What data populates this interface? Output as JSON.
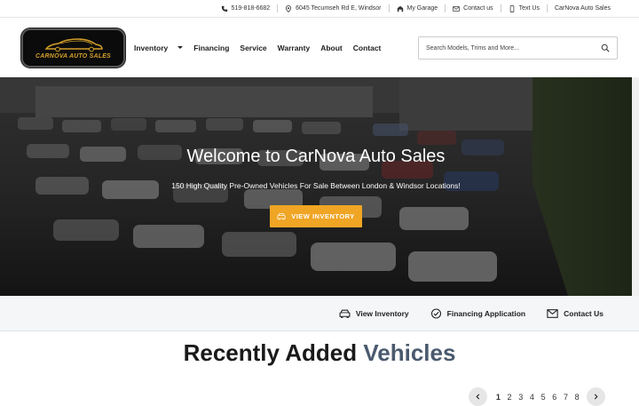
{
  "topbar": {
    "phone": "519-818-6682",
    "address": "6045 Tecumseh Rd E, Windsor",
    "garage": "My Garage",
    "contact": "Contact us",
    "text": "Text Us",
    "dealer": "CarNova Auto Sales"
  },
  "logo": {
    "name": "CARNOVA AUTO SALES"
  },
  "nav": {
    "inventory": "Inventory",
    "financing": "Financing",
    "service": "Service",
    "warranty": "Warranty",
    "about": "About",
    "contact": "Contact"
  },
  "search": {
    "placeholder": "Search Models, Trims and More..."
  },
  "hero": {
    "title": "Welcome to CarNova Auto Sales",
    "subtitle": "150 High Quality Pre-Owned Vehicles For Sale Between London & Windsor Locations!",
    "button": "VIEW INVENTORY"
  },
  "quick": {
    "inventory": "View Inventory",
    "financing": "Financing Application",
    "contact": "Contact Us"
  },
  "recent": {
    "title_main": "Recently Added",
    "title_accent": "Vehicles"
  },
  "pagination": {
    "pages": [
      "1",
      "2",
      "3",
      "4",
      "5",
      "6",
      "7",
      "8"
    ],
    "current": "1"
  },
  "colors": {
    "accent": "#f0a525",
    "logo_gold": "#d4a02a",
    "heading_accent": "#4a5a6e"
  }
}
